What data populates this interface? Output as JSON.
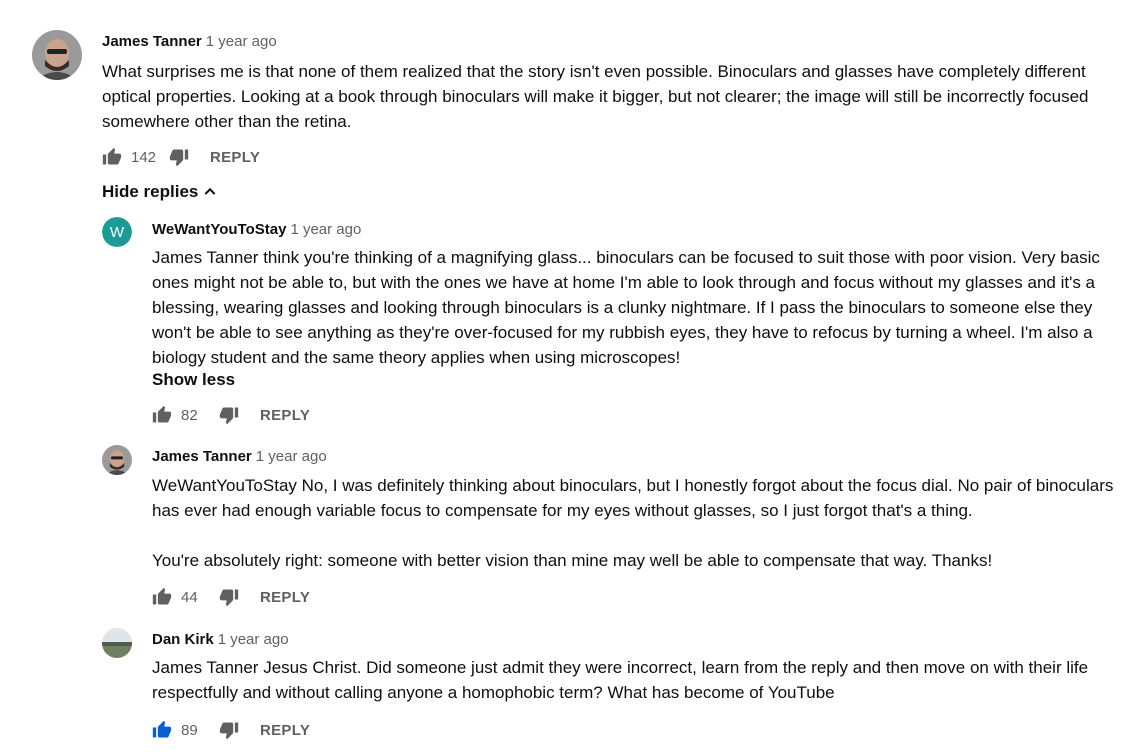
{
  "comments": [
    {
      "author": "James Tanner",
      "time": "1 year ago",
      "text": "What surprises me is that none of them realized that the story isn't even possible. Binoculars and glasses have completely different optical properties. Looking at a book through binoculars will make it bigger, but not clearer; the image will still be incorrectly focused somewhere other than the retina.",
      "likes": "142",
      "reply_label": "REPLY"
    }
  ],
  "hide_replies_label": "Hide replies",
  "replies": [
    {
      "author": "WeWantYouToStay",
      "avatar_letter": "W",
      "time": "1 year ago",
      "text": "James Tanner think you're thinking of a magnifying glass... binoculars can be focused to suit those with poor vision. Very basic ones might not be able to, but with the ones we have at home I'm able to look through and focus without my glasses and it's a blessing, wearing glasses and looking through binoculars is a clunky nightmare. If I pass the binoculars to someone else they won't be able to see anything as they're over-focused for my rubbish eyes, they have to refocus by turning a wheel. I'm also a biology student and the same theory applies when using microscopes!",
      "show_less_label": "Show less",
      "likes": "82",
      "reply_label": "REPLY"
    },
    {
      "author": "James Tanner",
      "time": "1 year ago",
      "text_p1": "WeWantYouToStay No, I was definitely thinking about binoculars, but I honestly forgot about the focus dial. No pair of binoculars has ever had enough variable focus to compensate for my eyes without glasses, so I just forgot that's a thing.",
      "text_p2": "You're absolutely right: someone with better vision than mine may well be able to compensate that way. Thanks!",
      "likes": "44",
      "reply_label": "REPLY"
    },
    {
      "author": "Dan Kirk",
      "time": "1 year ago",
      "text": "James Tanner Jesus Christ. Did someone just admit they were incorrect, learn from the reply and then move on with their life respectfully and without calling anyone a homophobic term? What has become of YouTube",
      "likes": "89",
      "liked": true,
      "reply_label": "REPLY"
    }
  ],
  "colors": {
    "text": "#0f0f0f",
    "secondary": "#606060",
    "liked": "#065fd4",
    "avatar_w": "#1b9a97"
  },
  "icons": [
    "thumb-up-icon",
    "thumb-down-icon",
    "chevron-up-icon"
  ]
}
